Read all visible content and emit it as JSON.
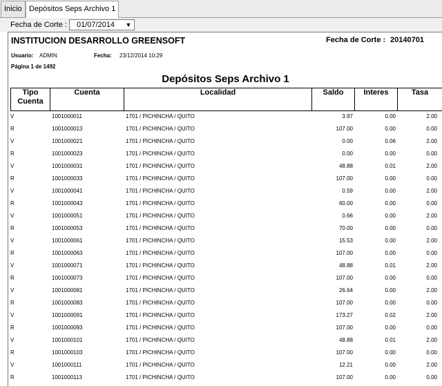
{
  "tabs": [
    {
      "label": "Inicio"
    },
    {
      "label": "Depósitos Seps Archivo 1"
    }
  ],
  "filter": {
    "fecha_label": "Fecha de Corte :",
    "fecha_value": "01/07/2014"
  },
  "report": {
    "institution": "INSTITUCION DESARROLLO GREENSOFT",
    "corte_label": "Fecha de Corte :",
    "corte_value": "20140701",
    "usuario_label": "Usuario:",
    "usuario_value": "ADMIN",
    "fecha_label": "Fecha:",
    "fecha_value": "23/12/2014 10:29",
    "pagina": "Página 1 de 1492",
    "title": "Depósitos Seps Archivo 1",
    "columns": {
      "tipo_line1": "Tipo",
      "tipo_line2": "Cuenta",
      "cuenta": "Cuenta",
      "localidad": "Localidad",
      "saldo": "Saldo",
      "interes": "Interes",
      "tasa": "Tasa"
    },
    "rows": [
      {
        "tipo": "V",
        "cuenta": "1001000011",
        "localidad": "1701 / PICHINCHA / QUITO",
        "saldo": "3.97",
        "interes": "0.00",
        "tasa": "2.00"
      },
      {
        "tipo": "R",
        "cuenta": "1001000013",
        "localidad": "1701 / PICHINCHA / QUITO",
        "saldo": "107.00",
        "interes": "0.00",
        "tasa": "0.00"
      },
      {
        "tipo": "V",
        "cuenta": "1001000021",
        "localidad": "1701 / PICHINCHA / QUITO",
        "saldo": "0.00",
        "interes": "0.06",
        "tasa": "2.00"
      },
      {
        "tipo": "R",
        "cuenta": "1001000023",
        "localidad": "1701 / PICHINCHA / QUITO",
        "saldo": "0.00",
        "interes": "0.00",
        "tasa": "0.00"
      },
      {
        "tipo": "V",
        "cuenta": "1001000031",
        "localidad": "1701 / PICHINCHA / QUITO",
        "saldo": "48.88",
        "interes": "0.01",
        "tasa": "2.00"
      },
      {
        "tipo": "R",
        "cuenta": "1001000033",
        "localidad": "1701 / PICHINCHA / QUITO",
        "saldo": "107.00",
        "interes": "0.00",
        "tasa": "0.00"
      },
      {
        "tipo": "V",
        "cuenta": "1001000041",
        "localidad": "1701 / PICHINCHA / QUITO",
        "saldo": "0.59",
        "interes": "0.00",
        "tasa": "2.00"
      },
      {
        "tipo": "R",
        "cuenta": "1001000043",
        "localidad": "1701 / PICHINCHA / QUITO",
        "saldo": "60.00",
        "interes": "0.00",
        "tasa": "0.00"
      },
      {
        "tipo": "V",
        "cuenta": "1001000051",
        "localidad": "1701 / PICHINCHA / QUITO",
        "saldo": "0.66",
        "interes": "0.00",
        "tasa": "2.00"
      },
      {
        "tipo": "R",
        "cuenta": "1001000053",
        "localidad": "1701 / PICHINCHA / QUITO",
        "saldo": "70.00",
        "interes": "0.00",
        "tasa": "0.00"
      },
      {
        "tipo": "V",
        "cuenta": "1001000061",
        "localidad": "1701 / PICHINCHA / QUITO",
        "saldo": "15.53",
        "interes": "0.00",
        "tasa": "2.00"
      },
      {
        "tipo": "R",
        "cuenta": "1001000063",
        "localidad": "1701 / PICHINCHA / QUITO",
        "saldo": "107.00",
        "interes": "0.00",
        "tasa": "0.00"
      },
      {
        "tipo": "V",
        "cuenta": "1001000071",
        "localidad": "1701 / PICHINCHA / QUITO",
        "saldo": "48.88",
        "interes": "0.01",
        "tasa": "2.00"
      },
      {
        "tipo": "R",
        "cuenta": "1001000073",
        "localidad": "1701 / PICHINCHA / QUITO",
        "saldo": "107.00",
        "interes": "0.00",
        "tasa": "0.00"
      },
      {
        "tipo": "V",
        "cuenta": "1001000081",
        "localidad": "1701 / PICHINCHA / QUITO",
        "saldo": "26.64",
        "interes": "0.00",
        "tasa": "2.00"
      },
      {
        "tipo": "R",
        "cuenta": "1001000083",
        "localidad": "1701 / PICHINCHA / QUITO",
        "saldo": "107.00",
        "interes": "0.00",
        "tasa": "0.00"
      },
      {
        "tipo": "V",
        "cuenta": "1001000091",
        "localidad": "1701 / PICHINCHA / QUITO",
        "saldo": "173.27",
        "interes": "0.02",
        "tasa": "2.00"
      },
      {
        "tipo": "R",
        "cuenta": "1001000093",
        "localidad": "1701 / PICHINCHA / QUITO",
        "saldo": "107.00",
        "interes": "0.00",
        "tasa": "0.00"
      },
      {
        "tipo": "V",
        "cuenta": "1001000101",
        "localidad": "1701 / PICHINCHA / QUITO",
        "saldo": "48.88",
        "interes": "0.01",
        "tasa": "2.00"
      },
      {
        "tipo": "R",
        "cuenta": "1001000103",
        "localidad": "1701 / PICHINCHA / QUITO",
        "saldo": "107.00",
        "interes": "0.00",
        "tasa": "0.00"
      },
      {
        "tipo": "V",
        "cuenta": "1001000111",
        "localidad": "1701 / PICHINCHA / QUITO",
        "saldo": "12.21",
        "interes": "0.00",
        "tasa": "2.00"
      },
      {
        "tipo": "R",
        "cuenta": "1001000113",
        "localidad": "1701 / PICHINCHA / QUITO",
        "saldo": "107.00",
        "interes": "0.00",
        "tasa": "0.00"
      }
    ]
  }
}
